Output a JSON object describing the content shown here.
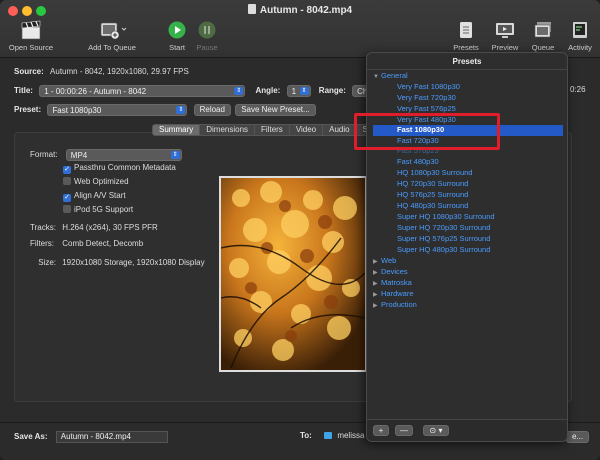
{
  "window": {
    "title": "Autumn - 8042.mp4"
  },
  "toolbar": {
    "open_source": "Open Source",
    "add_to_queue": "Add To Queue",
    "start": "Start",
    "pause": "Pause",
    "presets": "Presets",
    "preview": "Preview",
    "queue": "Queue",
    "activity": "Activity"
  },
  "source": {
    "label": "Source:",
    "value": "Autumn - 8042, 1920x1080, 29.97 FPS"
  },
  "title_row": {
    "title_label": "Title:",
    "title_value": "1 - 00:00:26 - Autumn - 8042",
    "angle_label": "Angle:",
    "angle_value": "1",
    "range_label": "Range:",
    "range_value": "Ch",
    "duration_tail": "0:26"
  },
  "preset_row": {
    "label": "Preset:",
    "value": "Fast 1080p30",
    "reload": "Reload",
    "save_new": "Save New Preset..."
  },
  "tabs": [
    "Summary",
    "Dimensions",
    "Filters",
    "Video",
    "Audio",
    "S"
  ],
  "summary": {
    "format_label": "Format:",
    "format_value": "MP4",
    "options": [
      {
        "label": "Passthru Common Metadata",
        "checked": true
      },
      {
        "label": "Web Optimized",
        "checked": false
      },
      {
        "label": "Align A/V Start",
        "checked": true
      },
      {
        "label": "iPod 5G Support",
        "checked": false
      }
    ],
    "tracks_label": "Tracks:",
    "tracks_value": "H.264 (x264), 30 FPS PFR",
    "filters_label": "Filters:",
    "filters_value": "Comb Detect, Decomb",
    "size_label": "Size:",
    "size_value": "1920x1080 Storage, 1920x1080 Display"
  },
  "bottom": {
    "save_as_label": "Save As:",
    "save_as_value": "Autumn - 8042.mp4",
    "to_label": "To:",
    "to_value": "melissa",
    "browse": "e..."
  },
  "presets_panel": {
    "title": "Presets",
    "general_label": "General",
    "general_items": [
      "Very Fast 1080p30",
      "Very Fast 720p30",
      "Very Fast 576p25",
      "Very Fast 480p30",
      "Fast 1080p30",
      "Fast 720p30",
      "Fast 576p25",
      "Fast 480p30",
      "HQ 1080p30 Surround",
      "HQ 720p30 Surround",
      "HQ 576p25 Surround",
      "HQ 480p30 Surround",
      "Super HQ 1080p30 Surround",
      "Super HQ 720p30 Surround",
      "Super HQ 576p25 Surround",
      "Super HQ 480p30 Surround"
    ],
    "selected": "Fast 1080p30",
    "other_categories": [
      "Web",
      "Devices",
      "Matroska",
      "Hardware",
      "Production"
    ],
    "add": "+",
    "remove": "—",
    "options": "⊙ ▾"
  },
  "colors": {
    "accent": "#2459c8",
    "link": "#4a9cff",
    "highlight_box": "#e01d2a"
  }
}
